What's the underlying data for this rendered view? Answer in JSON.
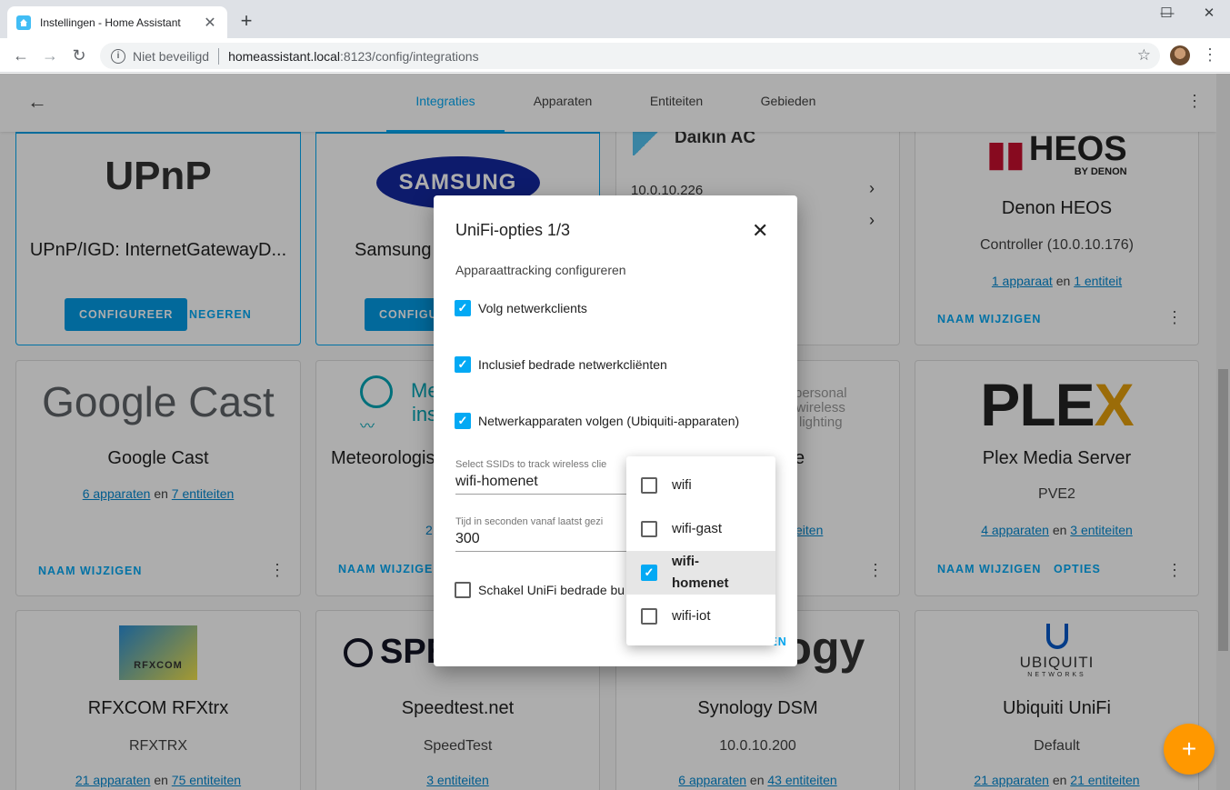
{
  "browser": {
    "tab_title": "Instellingen - Home Assistant",
    "security_label": "Niet beveiligd",
    "url_host": "homeassistant.local",
    "url_rest": ":8123/config/integrations"
  },
  "header": {
    "tabs": [
      {
        "label": "Integraties"
      },
      {
        "label": "Apparaten"
      },
      {
        "label": "Entiteiten"
      },
      {
        "label": "Gebieden"
      }
    ]
  },
  "cards": {
    "upnp": {
      "logo": "UPnP",
      "title": "UPnP/IGD: InternetGatewayD...",
      "configure": "CONFIGUREER",
      "ignore": "NEGEREN"
    },
    "samsung": {
      "logo": "SAMSUNG",
      "title": "Samsung",
      "configure": "CONFIGUREER"
    },
    "daikin": {
      "title": "Daikin AC",
      "ip": "10.0.10.226"
    },
    "heos": {
      "logo_main": "HEOS",
      "logo_sub": "BY DENON",
      "title": "Denon HEOS",
      "sub": "Controller (10.0.10.176)",
      "devices": "1 apparaat",
      "and": "en",
      "entities": "1 entiteit",
      "rename": "NAAM WIJZIGEN"
    },
    "cast": {
      "logo": "Google Cast",
      "title": "Google Cast",
      "devices": "6 apparaten",
      "and": "en",
      "entities": "7 entiteiten",
      "rename": "NAAM WIJZIGEN"
    },
    "meteo": {
      "logo": "Me ins",
      "title": "Meteorologis",
      "count_partial": "2",
      "rename": "NAAM WIJZIGEN"
    },
    "ppl": {
      "logo_lines": [
        "personal",
        "wireless",
        "lighting"
      ],
      "title_partial": "e",
      "entities": "iteiten"
    },
    "plex": {
      "logo_main": "PLE",
      "logo_x": "X",
      "title": "Plex Media Server",
      "sub": "PVE2",
      "devices": "4 apparaten",
      "and": "en",
      "entities": "3 entiteiten",
      "rename": "NAAM WIJZIGEN",
      "options": "OPTIES"
    },
    "rfxcom": {
      "logo": "RFXCOM",
      "title": "RFXCOM RFXtrx",
      "sub": "RFXTRX",
      "devices": "21 apparaten",
      "and": "en",
      "entities": "75 entiteiten"
    },
    "speedtest": {
      "logo": "SPE",
      "title": "Speedtest.net",
      "sub": "SpeedTest",
      "entities": "3 entiteiten"
    },
    "synology": {
      "logo": "ology",
      "title": "Synology DSM",
      "sub": "10.0.10.200",
      "devices": "6 apparaten",
      "and": "en",
      "entities": "43 entiteiten"
    },
    "ubiquiti": {
      "logo_main": "UBIQUITI",
      "logo_sub": "NETWORKS",
      "title": "Ubiquiti UniFi",
      "sub": "Default",
      "devices": "21 apparaten",
      "and": "en",
      "entities": "21 entiteiten"
    }
  },
  "dialog": {
    "title": "UniFi-opties 1/3",
    "description": "Apparaattracking configureren",
    "checks": [
      {
        "label": "Volg netwerkclients",
        "checked": true
      },
      {
        "label": "Inclusief bedrade netwerkcliënten",
        "checked": true
      },
      {
        "label": "Netwerkapparaten volgen (Ubiquiti-apparaten)",
        "checked": true
      },
      {
        "label": "Schakel UniFi bedrade bu",
        "checked": false
      }
    ],
    "ssid_field": {
      "label": "Select SSIDs to track wireless clie",
      "value": "wifi-homenet"
    },
    "time_field": {
      "label": "Tijd in seconden vanaf laatst gezi",
      "value": "300"
    },
    "submit_partial": "SCHAKEN"
  },
  "dropdown": {
    "options": [
      {
        "label": "wifi",
        "checked": false
      },
      {
        "label": "wifi-gast",
        "checked": false
      },
      {
        "label": "wifi-homenet",
        "checked": true
      },
      {
        "label": "wifi-iot",
        "checked": false
      }
    ]
  },
  "colors": {
    "accent": "#03a9f4",
    "fab": "#ff9800"
  }
}
